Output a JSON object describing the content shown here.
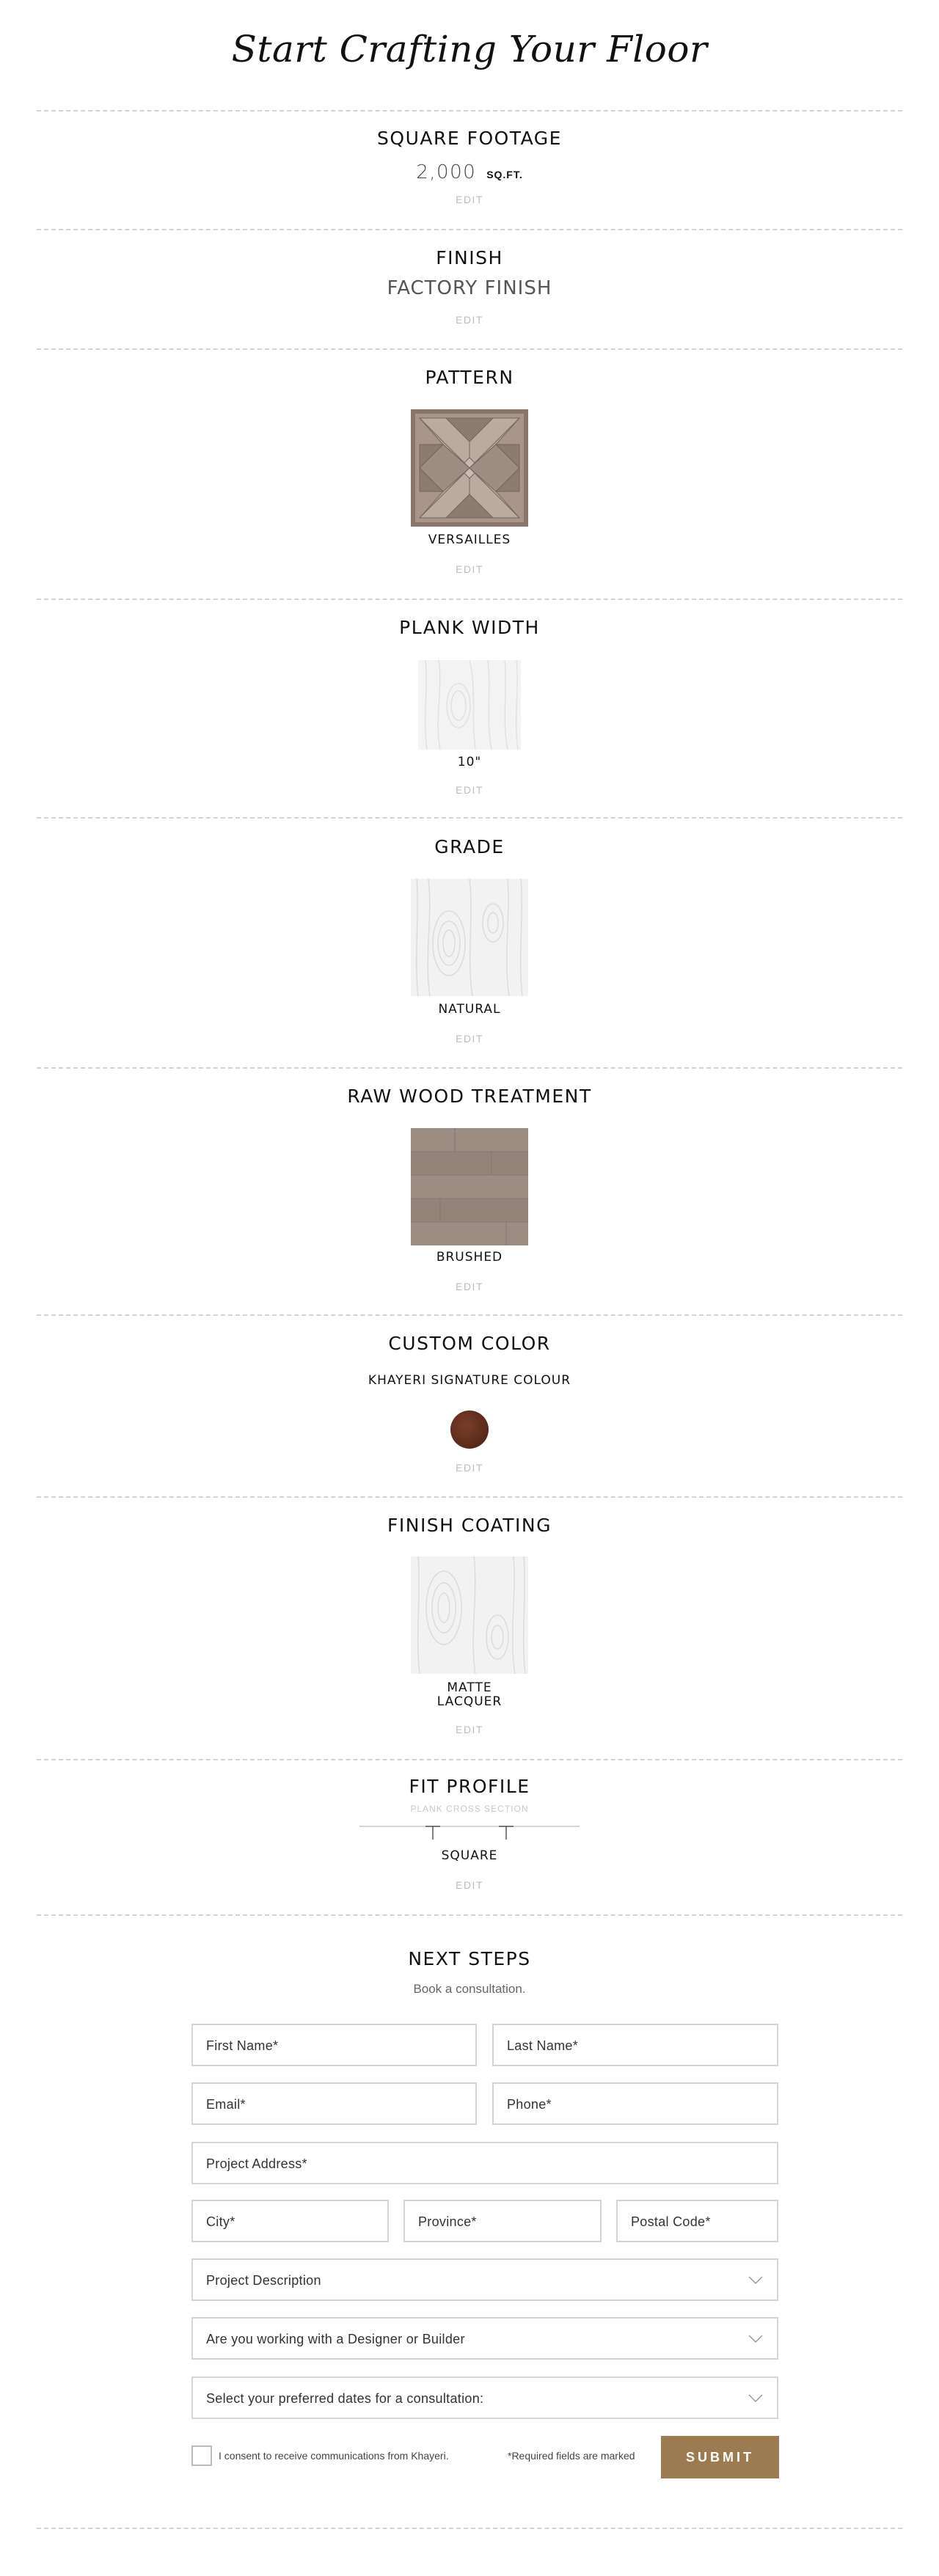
{
  "page": {
    "title": "Start Crafting Your Floor"
  },
  "square_footage": {
    "title": "SQUARE FOOTAGE",
    "value": "2,000",
    "unit": "SQ.FT.",
    "edit": "EDIT"
  },
  "finish": {
    "title": "FINISH",
    "value": "FACTORY FINISH",
    "edit": "EDIT"
  },
  "pattern": {
    "title": "PATTERN",
    "label": "VERSAILLES",
    "edit": "EDIT"
  },
  "plank_width": {
    "title": "PLANK WIDTH",
    "label": "10\"",
    "edit": "EDIT"
  },
  "grade": {
    "title": "GRADE",
    "label": "NATURAL",
    "edit": "EDIT"
  },
  "raw_wood_treatment": {
    "title": "RAW WOOD TREATMENT",
    "label": "BRUSHED",
    "edit": "EDIT"
  },
  "custom_color": {
    "title": "CUSTOM COLOR",
    "label": "KHAYERI SIGNATURE COLOUR",
    "swatch_color": "#5e2a17",
    "edit": "EDIT"
  },
  "finish_coating": {
    "title": "FINISH COATING",
    "label_line1": "MATTE",
    "label_line2": "LACQUER",
    "edit": "EDIT"
  },
  "fit_profile": {
    "title": "FIT PROFILE",
    "subtitle": "PLANK CROSS SECTION",
    "label": "SQUARE",
    "edit": "EDIT"
  },
  "next_steps": {
    "title": "NEXT STEPS",
    "subtitle": "Book a consultation.",
    "fields": {
      "first_name": "First Name*",
      "last_name": "Last Name*",
      "email": "Email*",
      "phone": "Phone*",
      "project_address": "Project Address*",
      "city": "City*",
      "province": "Province*",
      "postal_code": "Postal Code*"
    },
    "selects": {
      "project_description": "Project Description",
      "designer_builder": "Are you working with a Designer or Builder",
      "preferred_dates": "Select your preferred dates for a consultation:"
    },
    "consent": "I consent to receive communications from Khayeri.",
    "required_note": "*Required fields are marked",
    "submit": "SUBMIT"
  },
  "colors": {
    "accent": "#9b7b4f",
    "divider": "#d2d2d2",
    "edit": "#bdbdbd"
  }
}
